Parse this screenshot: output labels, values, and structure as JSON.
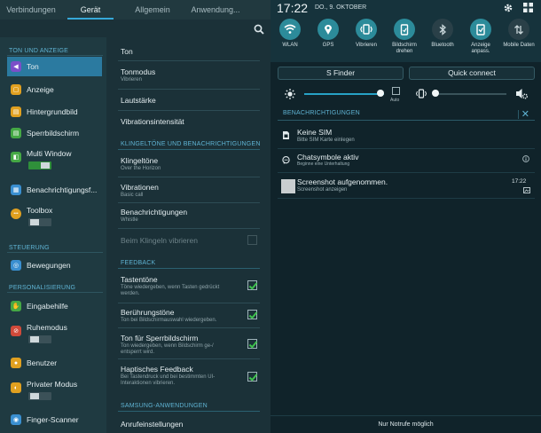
{
  "settings": {
    "tabs": [
      {
        "label": "Verbindungen"
      },
      {
        "label": "Gerät"
      },
      {
        "label": "Allgemein"
      },
      {
        "label": "Anwendung..."
      }
    ],
    "sidebar": {
      "categories": {
        "ton": "TON UND ANZEIGE",
        "steuerung": "STEUERUNG",
        "personal": "PERSONALISIERUNG"
      },
      "items": [
        {
          "label": "Ton",
          "icon": "speaker-icon",
          "color": "#7b4fc8",
          "glyph": "◀"
        },
        {
          "label": "Anzeige",
          "icon": "display-icon",
          "color": "#e0a020",
          "glyph": "▢"
        },
        {
          "label": "Hintergrundbild",
          "icon": "wallpaper-icon",
          "color": "#e0a020",
          "glyph": "▤"
        },
        {
          "label": "Sperrbildschirm",
          "icon": "lockscreen-icon",
          "color": "#45a845",
          "glyph": "▤"
        },
        {
          "label": "Multi Window",
          "icon": "multiwindow-icon",
          "color": "#45a845",
          "glyph": "◧",
          "toggle": "on"
        },
        {
          "label": "Benachrichtigungsf...",
          "icon": "notification-panel-icon",
          "color": "#3a8fd0",
          "glyph": "▦"
        },
        {
          "label": "Toolbox",
          "icon": "toolbox-icon",
          "color": "#e0a020",
          "glyph": "•••",
          "toggle": "off"
        },
        {
          "label": "Bewegungen",
          "icon": "motion-icon",
          "color": "#3a8fd0",
          "glyph": "◎"
        },
        {
          "label": "Eingabehilfe",
          "icon": "accessibility-icon",
          "color": "#45a845",
          "glyph": "✋"
        },
        {
          "label": "Ruhemodus",
          "icon": "blocking-mode-icon",
          "color": "#d04a3a",
          "glyph": "⊘",
          "toggle": "off"
        },
        {
          "label": "Benutzer",
          "icon": "users-icon",
          "color": "#e0a020",
          "glyph": "●"
        },
        {
          "label": "Privater Modus",
          "icon": "private-mode-icon",
          "color": "#e0a020",
          "glyph": "◐",
          "toggle": "off"
        },
        {
          "label": "Finger-Scanner",
          "icon": "fingerprint-icon",
          "color": "#3a8fd0",
          "glyph": "◉"
        }
      ]
    },
    "main": {
      "rows": [
        {
          "title": "Ton",
          "sub": ""
        },
        {
          "title": "Tonmodus",
          "sub": "Vibrieren"
        },
        {
          "title": "Lautstärke",
          "sub": ""
        },
        {
          "title": "Vibrationsintensität",
          "sub": ""
        },
        {
          "title": "Klingeltöne",
          "sub": "Over the Horizon"
        },
        {
          "title": "Vibrationen",
          "sub": "Basic call"
        },
        {
          "title": "Benachrichtigungen",
          "sub": "Whistle"
        },
        {
          "title": "Beim Klingeln vibrieren",
          "sub": "",
          "checkbox": false,
          "disabled": true
        },
        {
          "title": "Tastentöne",
          "sub": "Töne wiedergeben, wenn Tasten gedrückt werden.",
          "checkbox": true
        },
        {
          "title": "Berührungstöne",
          "sub": "Ton bei Bildschirmauswahl wiedergeben.",
          "checkbox": true
        },
        {
          "title": "Ton für Sperrbildschirm",
          "sub": "Ton wiedergeben, wenn Bildschirm ge-/ entsperrt wird.",
          "checkbox": true
        },
        {
          "title": "Haptisches Feedback",
          "sub": "Bei Tastendruck und bei bestimmten UI-Interaktionen vibrieren.",
          "checkbox": true
        },
        {
          "title": "Anrufeinstellungen",
          "sub": ""
        }
      ],
      "categories": {
        "klingel": "KLINGELTÖNE UND BENACHRICHTIGUNGEN",
        "feedback": "FEEDBACK",
        "samsung": "SAMSUNG-ANWENDUNGEN"
      }
    }
  },
  "panel": {
    "status": {
      "time": "17:22",
      "date": "DO., 9. OKTOBER"
    },
    "quick": [
      {
        "label": "WLAN",
        "icon": "wifi-icon",
        "on": true
      },
      {
        "label": "GPS",
        "icon": "gps-icon",
        "on": true
      },
      {
        "label": "Vibrieren",
        "icon": "vibrate-icon",
        "on": true
      },
      {
        "label": "Bildschirm drehen",
        "icon": "rotate-icon",
        "on": true
      },
      {
        "label": "Bluetooth",
        "icon": "bluetooth-icon",
        "on": false
      },
      {
        "label": "Anzeige anpass.",
        "icon": "adapt-display-icon",
        "on": true
      },
      {
        "label": "Mobile Daten",
        "icon": "mobile-data-icon",
        "on": false
      }
    ],
    "buttons": {
      "finder": "S Finder",
      "quick_connect": "Quick connect"
    },
    "brightness": {
      "level": 0.95,
      "auto_label": "Auto",
      "auto": false
    },
    "volume": {
      "level": 0.0
    },
    "notifications_header": "BENACHRICHTIGUNGEN",
    "notifications": [
      {
        "title": "Keine SIM",
        "sub": "Bitte SIM Karte einlegen",
        "time": "",
        "icon": "sim-icon"
      },
      {
        "title": "Chatsymbole aktiv",
        "sub": "Beginne eine Unterhaltung",
        "time": "",
        "icon": "chat-icon"
      },
      {
        "title": "Screenshot aufgenommen.",
        "sub": "Screenshot anzeigen",
        "time": "17:22",
        "icon": "screenshot-thumbnail"
      }
    ],
    "footer": "Nur Notrufe möglich"
  }
}
